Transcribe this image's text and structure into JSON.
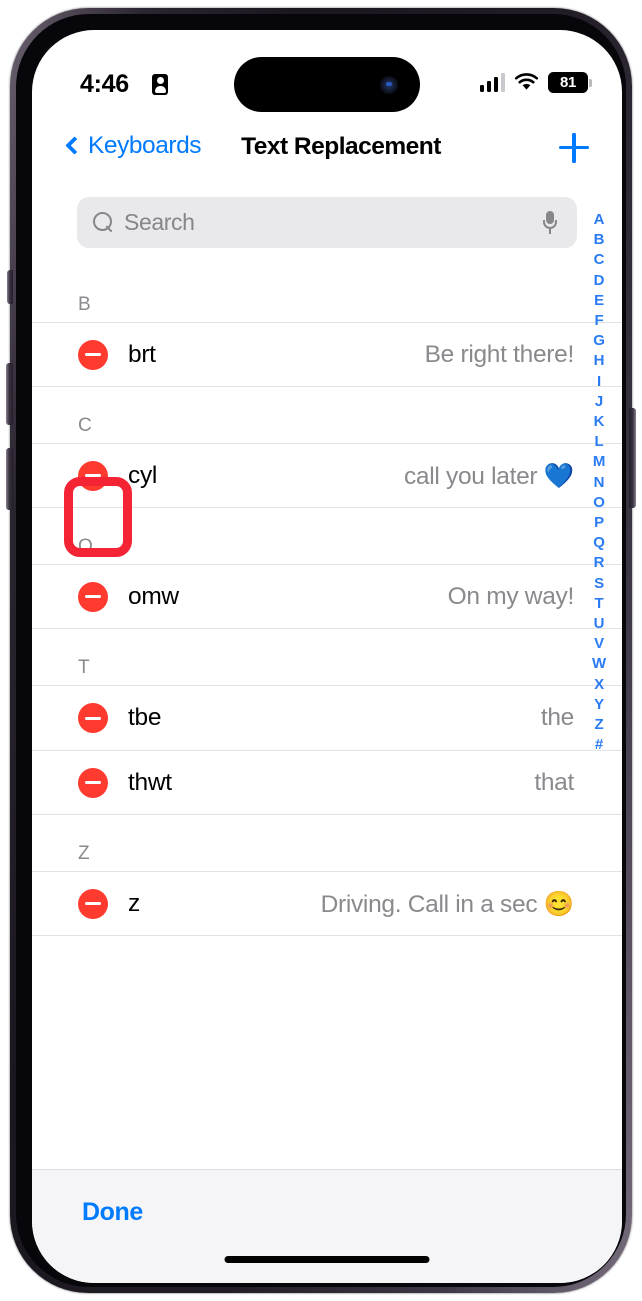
{
  "status_bar": {
    "time": "4:46",
    "lock_icon": "lock-portrait-icon",
    "signal_icon": "cellular-signal-icon",
    "wifi_icon": "wifi-icon",
    "battery_level": "81"
  },
  "nav_bar": {
    "back_label": "Keyboards",
    "back_icon": "chevron-left-icon",
    "title": "Text Replacement",
    "add_icon": "plus-icon"
  },
  "search": {
    "placeholder": "Search",
    "value": "",
    "search_icon": "search-icon",
    "mic_icon": "microphone-icon"
  },
  "list": {
    "sections": [
      {
        "letter": "B",
        "rows": [
          {
            "shortcut": "brt",
            "phrase": "Be right there!",
            "delete_icon": "minus-circle-icon"
          }
        ]
      },
      {
        "letter": "C",
        "rows": [
          {
            "shortcut": "cyl",
            "phrase": "call you later 💙",
            "delete_icon": "minus-circle-icon",
            "highlighted": true
          }
        ]
      },
      {
        "letter": "O",
        "rows": [
          {
            "shortcut": "omw",
            "phrase": "On my way!",
            "delete_icon": "minus-circle-icon"
          }
        ]
      },
      {
        "letter": "T",
        "rows": [
          {
            "shortcut": "tbe",
            "phrase": "the",
            "delete_icon": "minus-circle-icon"
          },
          {
            "shortcut": "thwt",
            "phrase": "that",
            "delete_icon": "minus-circle-icon"
          }
        ]
      },
      {
        "letter": "Z",
        "rows": [
          {
            "shortcut": "z",
            "phrase": "Driving. Call in a sec 😊",
            "delete_icon": "minus-circle-icon"
          }
        ]
      }
    ]
  },
  "alphabet_index": {
    "letters": [
      "A",
      "B",
      "C",
      "D",
      "E",
      "F",
      "G",
      "H",
      "I",
      "J",
      "K",
      "L",
      "M",
      "N",
      "O",
      "P",
      "Q",
      "R",
      "S",
      "T",
      "U",
      "V",
      "W",
      "X",
      "Y",
      "Z",
      "#"
    ]
  },
  "toolbar": {
    "done_label": "Done"
  },
  "colors": {
    "accent_blue": "#007aff",
    "index_blue": "#2b7bf3",
    "delete_red": "#ff3b30",
    "annotation_red": "#f42434",
    "secondary_text": "#8a8a8e",
    "search_bg": "#e9e9eb",
    "toolbar_bg": "#f5f5f7"
  }
}
